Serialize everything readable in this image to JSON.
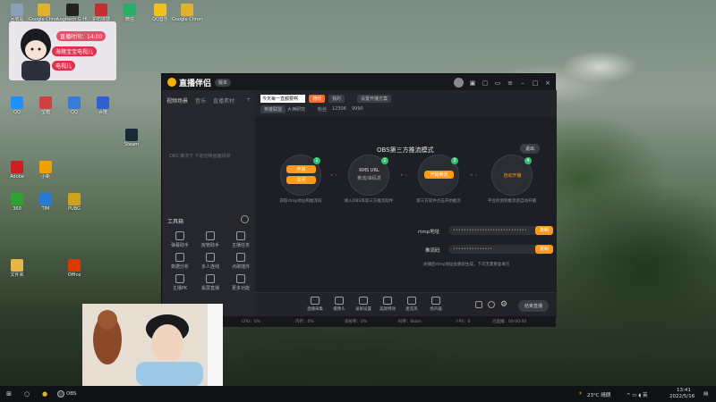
{
  "desktop_icons": [
    {
      "label": "回收站",
      "color": "#8aa0b8"
    },
    {
      "label": "Google Chrome",
      "color": "#e0b030"
    },
    {
      "label": "Logitech G HUB",
      "color": "#222222"
    },
    {
      "label": "护石体感",
      "color": "#c03030"
    },
    {
      "label": "微信",
      "color": "#2aae67"
    },
    {
      "label": "QQ音乐",
      "color": "#f0c020"
    },
    {
      "label": "Google Chrome",
      "color": "#e0b030"
    },
    {
      "label": "QQ",
      "color": "#1e90ff"
    },
    {
      "label": "宝箱",
      "color": "#d04040"
    },
    {
      "label": "QQ",
      "color": "#3a7bd5"
    },
    {
      "label": "百度",
      "color": "#3060d0"
    },
    {
      "label": "Adobe",
      "color": "#cc2020"
    },
    {
      "label": "小新",
      "color": "#f0a000"
    },
    {
      "label": "Steam",
      "color": "#1b2838"
    },
    {
      "label": "360",
      "color": "#30a030"
    },
    {
      "label": "TIM",
      "color": "#2a7ad5"
    },
    {
      "label": "PUBG",
      "color": "#d0a020"
    },
    {
      "label": "文件夹",
      "color": "#e6b84a"
    },
    {
      "label": "Office",
      "color": "#d83b01"
    }
  ],
  "overlay": {
    "time_badge": "直播时间：14:00",
    "name_badge": "海猪宝宝电视儿",
    "name_badge_2": "电视儿"
  },
  "app": {
    "name": "直播伴侣",
    "version": "版本",
    "stream_title": "今天每一直都要啊",
    "stream_tag": "游戏",
    "category": "我的",
    "setting_label": "设置开播方案",
    "category_badge": "英雄联盟",
    "room_label": "大神研究",
    "fans_label": "粉丝",
    "fans_value": "12306",
    "likes_value": "9990"
  },
  "left_panel": {
    "tabs": [
      "视频场景",
      "音乐",
      "直播素材"
    ],
    "scene_hint": "OBS 推流下 不能切换画面场景",
    "tools_title": "工具箱",
    "tools": [
      {
        "icon": "video-icon",
        "label": "弹幕助手"
      },
      {
        "icon": "user-icon",
        "label": "房管助手"
      },
      {
        "icon": "gift-icon",
        "label": "主播任务"
      },
      {
        "icon": "chart-icon",
        "label": "数据分析"
      },
      {
        "icon": "people-icon",
        "label": "多人连线"
      },
      {
        "icon": "music-icon",
        "label": "点歌插件"
      },
      {
        "icon": "pk-icon",
        "label": "主播PK"
      },
      {
        "icon": "screen-icon",
        "label": "投屏直播"
      },
      {
        "icon": "more-icon",
        "label": "更多功能"
      }
    ]
  },
  "main": {
    "mode_title": "OBS第三方推流模式",
    "exit_label": "退出",
    "steps": [
      {
        "num": "1",
        "top_button": "开启",
        "bottom_button": "关闭",
        "desc": "获取rtmp地址和推流码"
      },
      {
        "num": "2",
        "title": "RMS URL",
        "subtitle": "推流/串码发",
        "desc": "填入OBS等第三方推流软件"
      },
      {
        "num": "3",
        "button": "开始推流",
        "desc": "第三方软件点击开始推流"
      },
      {
        "num": "4",
        "title": "自动开播",
        "desc": "平台检测到推流后自动开播"
      }
    ],
    "rtmp_label": "rtmp地址",
    "rtmp_value": "••••••••••••••••••••••••••••",
    "key_label": "推流码",
    "key_value": "•••••••••••••••",
    "copy_label": "复制",
    "hint": "关播后rtmp地址会重新生成，下次无需重复填写"
  },
  "bottom_bar": {
    "buttons": [
      {
        "icon": "mic-icon",
        "label": "直播采集"
      },
      {
        "icon": "camera-icon",
        "label": "摄像头"
      },
      {
        "icon": "screen-icon",
        "label": "录屏设置"
      },
      {
        "icon": "effect-icon",
        "label": "美颜特效"
      },
      {
        "icon": "microphone-icon",
        "label": "麦克风"
      },
      {
        "icon": "speaker-icon",
        "label": "扬声器"
      }
    ],
    "start_label": "结束直播"
  },
  "status_bar": {
    "items": [
      "网络：优",
      "CPU：0%",
      "内存：0%",
      "丢帧率：0%",
      "码率：0kb/s",
      "FPS：0",
      "已直播：00:00:00"
    ]
  },
  "taskbar": {
    "app_label": "OBS",
    "weather": "23°C 晴朗",
    "time": "13:41",
    "date": "2022/5/16"
  }
}
